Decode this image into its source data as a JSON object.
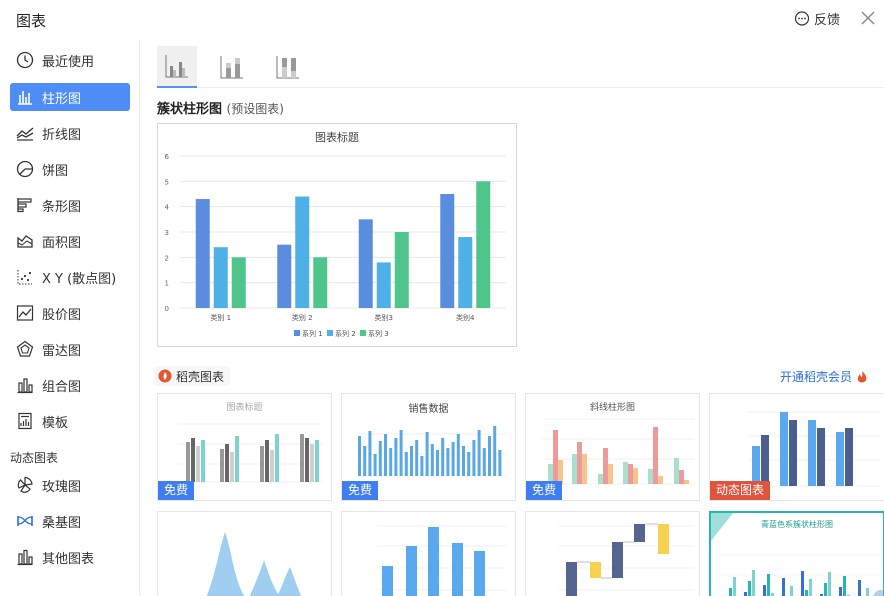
{
  "header": {
    "title": "图表",
    "feedback_label": "反馈"
  },
  "sidebar": {
    "items": [
      {
        "label": "最近使用",
        "icon": "clock-icon"
      },
      {
        "label": "柱形图",
        "icon": "column-chart-icon"
      },
      {
        "label": "折线图",
        "icon": "line-chart-icon"
      },
      {
        "label": "饼图",
        "icon": "pie-chart-icon"
      },
      {
        "label": "条形图",
        "icon": "bar-chart-icon"
      },
      {
        "label": "面积图",
        "icon": "area-chart-icon"
      },
      {
        "label": "X Y (散点图)",
        "icon": "scatter-chart-icon"
      },
      {
        "label": "股价图",
        "icon": "stock-chart-icon"
      },
      {
        "label": "雷达图",
        "icon": "radar-chart-icon"
      },
      {
        "label": "组合图",
        "icon": "combo-chart-icon"
      },
      {
        "label": "模板",
        "icon": "template-icon"
      }
    ],
    "section_dynamic": "动态图表",
    "dynamic_items": [
      {
        "label": "玫瑰图",
        "icon": "rose-chart-icon"
      },
      {
        "label": "桑基图",
        "icon": "sankey-chart-icon"
      },
      {
        "label": "其他图表",
        "icon": "other-chart-icon"
      }
    ]
  },
  "main": {
    "section_title": "簇状柱形图",
    "section_subtitle": "(预设图表)",
    "template_source": "稻壳图表",
    "vip_link": "开通稻壳会员",
    "cards": [
      {
        "title": "图表标题",
        "badge": "免费",
        "badge_type": "free"
      },
      {
        "title": "销售数据",
        "badge": "免费",
        "badge_type": "free"
      },
      {
        "title": "斜线柱形图",
        "badge": "免费",
        "badge_type": "free"
      },
      {
        "title": "",
        "badge": "动态图表",
        "badge_type": "dyn"
      },
      {
        "title": "",
        "badge": "",
        "badge_type": ""
      },
      {
        "title": "",
        "badge": "",
        "badge_type": ""
      },
      {
        "title": "",
        "badge": "",
        "badge_type": ""
      },
      {
        "title": "青蓝色系簇状柱形图",
        "badge": "",
        "badge_type": ""
      }
    ]
  },
  "chart_data": {
    "type": "bar",
    "title": "图表标题",
    "categories": [
      "类别 1",
      "类别 2",
      "类别3",
      "类别4"
    ],
    "ylim": [
      0,
      6
    ],
    "yticks": [
      0,
      1,
      2,
      3,
      4,
      5,
      6
    ],
    "series": [
      {
        "name": "系列 1",
        "color": "#5b8ddf",
        "values": [
          4.3,
          2.5,
          3.5,
          4.5
        ]
      },
      {
        "name": "系列 2",
        "color": "#4fb0e8",
        "values": [
          2.4,
          4.4,
          1.8,
          2.8
        ]
      },
      {
        "name": "系列 3",
        "color": "#4fc58b",
        "values": [
          2.0,
          2.0,
          3.0,
          5.0
        ]
      }
    ],
    "legend": "bottom",
    "grid": true
  }
}
